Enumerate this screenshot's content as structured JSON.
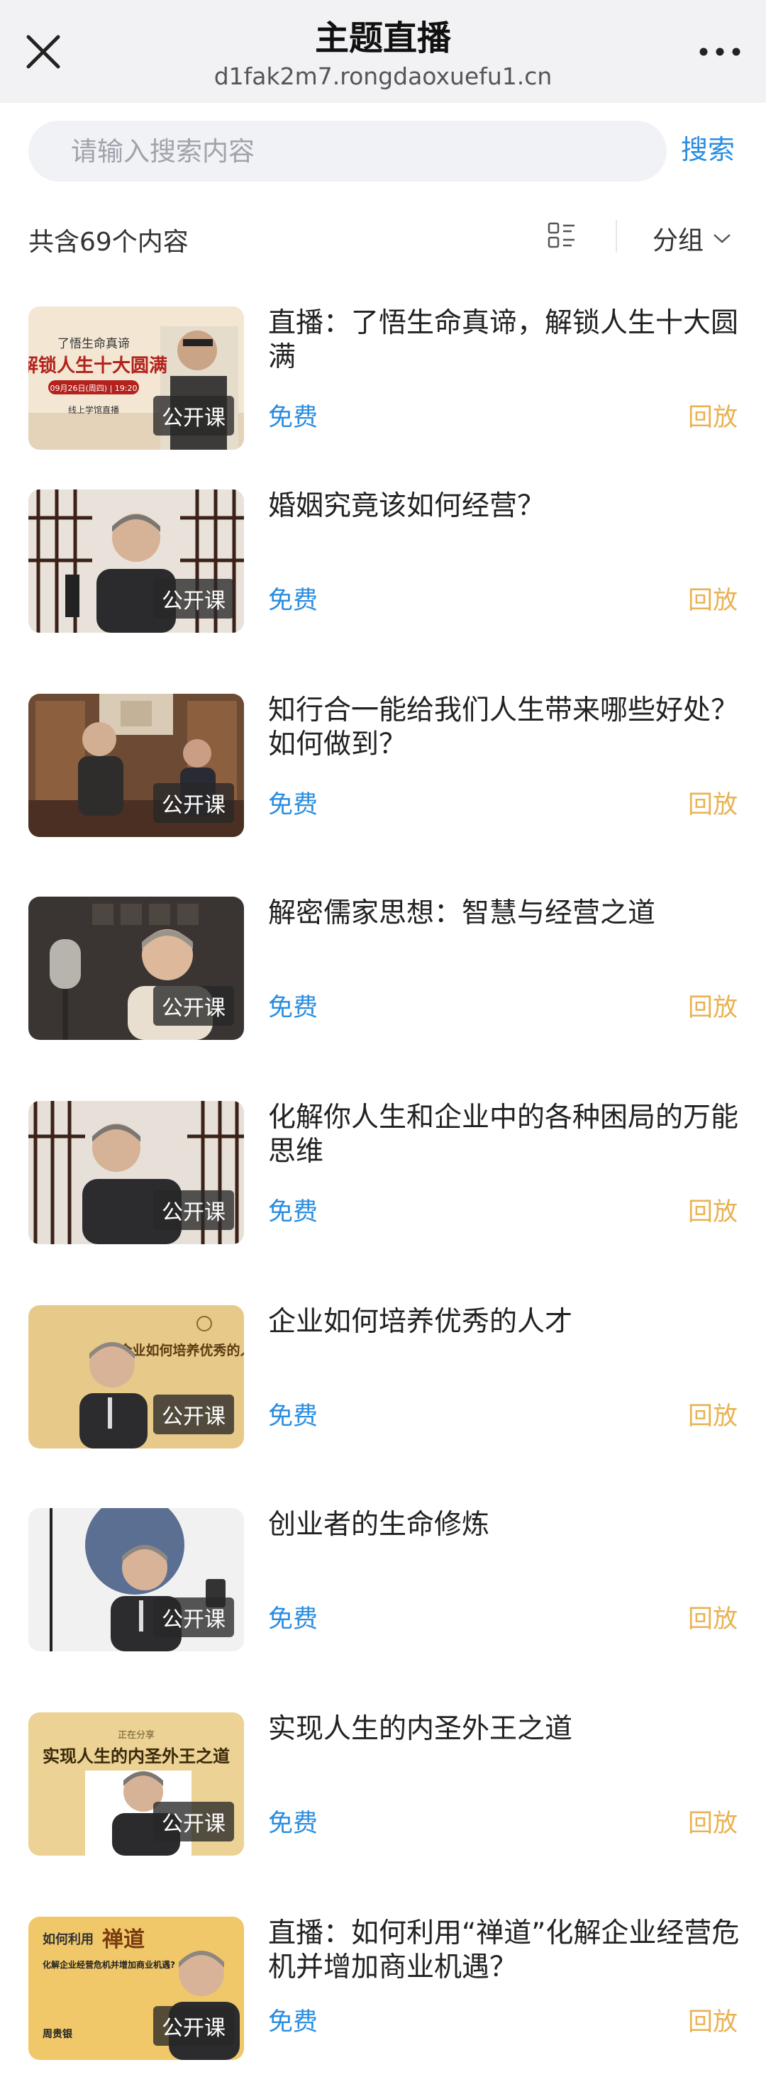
{
  "header": {
    "title": "主题直播",
    "url": "d1fak2m7.rongdaoxuefu1.cn"
  },
  "search": {
    "placeholder": "请输入搜索内容",
    "button_label": "搜索"
  },
  "toolbar": {
    "count_label": "共含69个内容",
    "group_label": "分组"
  },
  "items": [
    {
      "title": "直播：了悟生命真谛，解锁人生十大圆满",
      "badge": "公开课",
      "price": "免费",
      "replay": "回放",
      "thumb_text": {
        "kicker": "了悟生命真谛",
        "headline": "解锁人生十大圆满",
        "date": "09月26日(周四) | 19:20",
        "footer": "线上学馆直播"
      }
    },
    {
      "title": "婚姻究竟该如何经营？",
      "badge": "公开课",
      "price": "免费",
      "replay": "回放"
    },
    {
      "title": "知行合一能给我们人生带来哪些好处？如何做到？",
      "badge": "公开课",
      "price": "免费",
      "replay": "回放"
    },
    {
      "title": "解密儒家思想：智慧与经营之道",
      "badge": "公开课",
      "price": "免费",
      "replay": "回放"
    },
    {
      "title": "化解你人生和企业中的各种困局的万能思维",
      "badge": "公开课",
      "price": "免费",
      "replay": "回放"
    },
    {
      "title": "企业如何培养优秀的人才",
      "badge": "公开课",
      "price": "免费",
      "replay": "回放",
      "thumb_text": {
        "headline": "企业如何培养优秀的人才"
      }
    },
    {
      "title": "创业者的生命修炼",
      "badge": "公开课",
      "price": "免费",
      "replay": "回放"
    },
    {
      "title": "实现人生的内圣外王之道",
      "badge": "公开课",
      "price": "免费",
      "replay": "回放",
      "thumb_text": {
        "kicker": "正在分享",
        "headline": "实现人生的内圣外王之道"
      }
    },
    {
      "title": "直播：如何利用“禅道”化解企业经营危机并增加商业机遇？",
      "badge": "公开课",
      "price": "免费",
      "replay": "回放",
      "thumb_text": {
        "kicker": "如何利用",
        "mark": "禅道",
        "headline": "化解企业经营危机并增加商业机遇?",
        "name": "周贵银"
      }
    }
  ],
  "colors": {
    "accent": "#2a8de0",
    "replay": "#e9b252"
  },
  "icons": {
    "close": "close-icon",
    "more": "more-icon",
    "view": "list-view-icon",
    "chevron": "chevron-down-icon"
  }
}
